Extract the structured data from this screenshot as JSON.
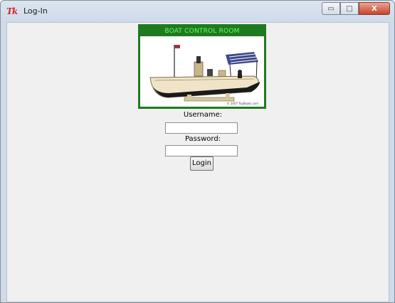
{
  "window": {
    "title": "Log-In",
    "logo_text": "Tk",
    "controls": {
      "minimize": "▭",
      "maximize": "□",
      "close": "X"
    }
  },
  "banner": {
    "title": "BOAT CONTROL ROOM",
    "copyright": "© 2007 ToyBoats.com"
  },
  "form": {
    "username_label": "Username:",
    "password_label": "Password:",
    "username_value": "",
    "password_value": "",
    "login_label": "Login"
  },
  "colors": {
    "banner_green": "#1f7a1f",
    "banner_text": "#66ff66",
    "close_red": "#c7442a"
  }
}
